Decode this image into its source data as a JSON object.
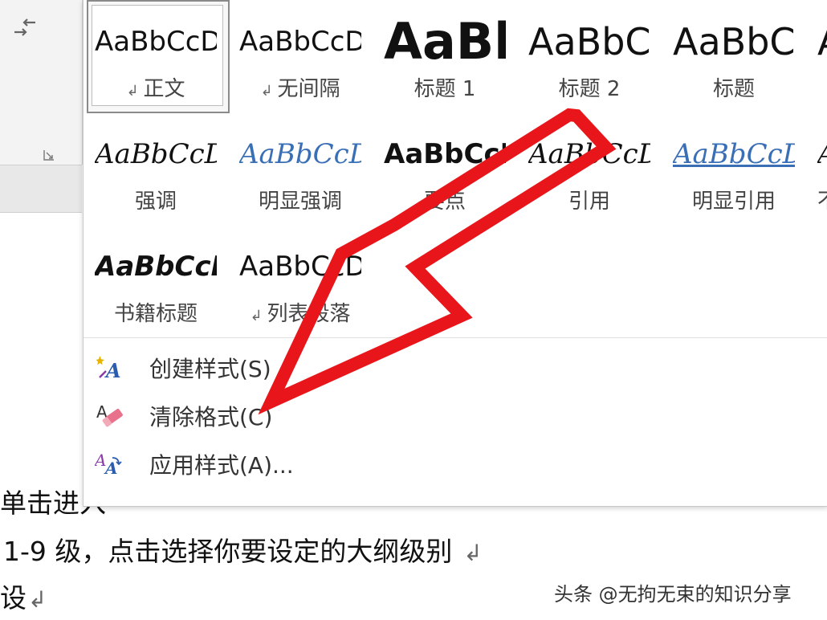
{
  "styles_gallery": {
    "tiles": [
      {
        "preview": "AaBbCcDd",
        "name": "正文",
        "arrow": "↲"
      },
      {
        "preview": "AaBbCcDd",
        "name": "无间隔",
        "arrow": "↲"
      },
      {
        "preview": "AaBb",
        "name": "标题 1"
      },
      {
        "preview": "AaBbC",
        "name": "标题 2"
      },
      {
        "preview": "AaBbC",
        "name": "标题"
      },
      {
        "preview": "A",
        "name": ""
      },
      {
        "preview": "AaBbCcDd",
        "name": "强调"
      },
      {
        "preview": "AaBbCcDd",
        "name": "明显强调"
      },
      {
        "preview": "AaBbCcD",
        "name": "要点"
      },
      {
        "preview": "AaBbCcDd",
        "name": "引用"
      },
      {
        "preview": "AaBbCcDd",
        "name": "明显引用"
      },
      {
        "preview": "A",
        "name": "不"
      },
      {
        "preview": "AaBbCcD",
        "name": "书籍标题"
      },
      {
        "preview": "AaBbCcDd",
        "name": "列表段落",
        "arrow": "↲"
      }
    ],
    "selected": "正文"
  },
  "menu": {
    "create_style": "创建样式(S)",
    "clear_formatting": "清除格式(C)",
    "apply_styles": "应用样式(A)..."
  },
  "document": {
    "line1": "单击进入",
    "line2": "1-9 级，点击选择你要设定的大纲级别",
    "line3": "设"
  },
  "watermark": "头条 @无拘无束的知识分享",
  "colors": {
    "arrow": "#e8161b",
    "accent": "#3a6fb5"
  },
  "icons": {
    "ribbon": "move-left-icon",
    "launcher": "dialog-launcher-icon"
  }
}
